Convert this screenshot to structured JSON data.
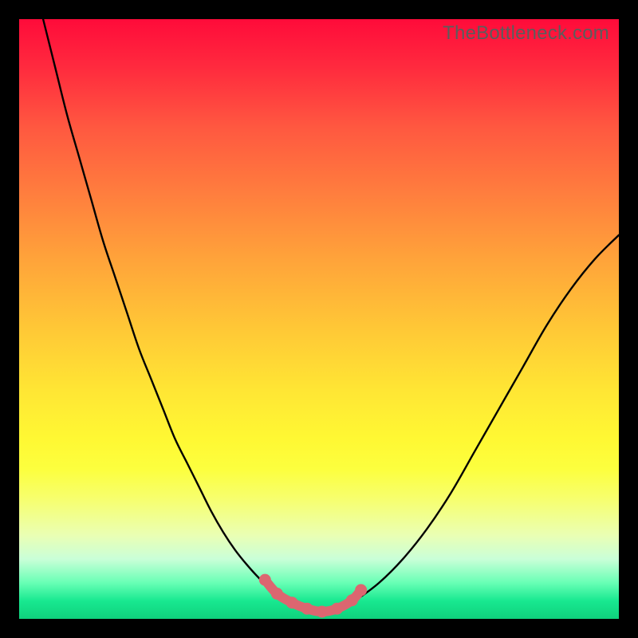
{
  "watermark": "TheBottleneck.com",
  "colors": {
    "curve": "#000000",
    "overlay_stroke": "#dc6670",
    "dot_fill": "#dc6670",
    "page_bg": "#000000"
  },
  "chart_data": {
    "type": "line",
    "title": "",
    "xlabel": "",
    "ylabel": "",
    "xlim": [
      0,
      100
    ],
    "ylim": [
      0,
      100
    ],
    "series": [
      {
        "name": "bottleneck-curve",
        "x": [
          4,
          6,
          8,
          10,
          12,
          14,
          16,
          18,
          20,
          22,
          24,
          26,
          28,
          30,
          32,
          34,
          36,
          38,
          40,
          42,
          44,
          46,
          48,
          50,
          52,
          54,
          56,
          60,
          64,
          68,
          72,
          76,
          80,
          84,
          88,
          92,
          96,
          100
        ],
        "y": [
          100,
          92,
          84,
          77,
          70,
          63,
          57,
          51,
          45,
          40,
          35,
          30,
          26,
          22,
          18,
          14.5,
          11.5,
          9,
          6.8,
          5,
          3.5,
          2.4,
          1.6,
          1.2,
          1.1,
          1.6,
          3,
          6,
          10,
          15,
          21,
          28,
          35,
          42,
          49,
          55,
          60,
          64
        ]
      },
      {
        "name": "highlight-segment",
        "x": [
          41,
          43,
          45.5,
          48,
          50.5,
          53,
          55.5,
          57
        ],
        "y": [
          6.5,
          4.2,
          2.7,
          1.7,
          1.2,
          1.7,
          3.1,
          4.8
        ]
      }
    ],
    "markers": [
      {
        "name": "dot-left-upper",
        "x": 41,
        "y": 6.5
      },
      {
        "name": "dot-left-lower",
        "x": 43,
        "y": 4.2
      },
      {
        "name": "dot-floor-1",
        "x": 45.5,
        "y": 2.7
      },
      {
        "name": "dot-floor-2",
        "x": 48,
        "y": 1.7
      },
      {
        "name": "dot-floor-3",
        "x": 50.5,
        "y": 1.2
      },
      {
        "name": "dot-floor-4",
        "x": 53,
        "y": 1.7
      },
      {
        "name": "dot-right-lower",
        "x": 55.5,
        "y": 3.1
      },
      {
        "name": "dot-right-upper",
        "x": 57,
        "y": 4.8
      }
    ]
  }
}
